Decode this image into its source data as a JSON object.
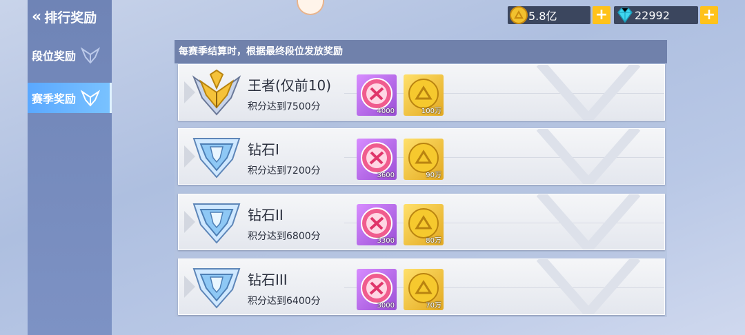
{
  "header": {
    "back_label": "排行奖励"
  },
  "nav": [
    {
      "label": "段位奖励",
      "active": false
    },
    {
      "label": "赛季奖励",
      "active": true
    }
  ],
  "currencies": {
    "coins": "5.8亿",
    "diamonds": "22992",
    "plus": "+"
  },
  "panel": {
    "notice": "每赛季结算时，根据最终段位发放奖励"
  },
  "ranks": [
    {
      "name": "王者(仅前10)",
      "requirement": "积分达到7500分",
      "reward1_qty": "4000",
      "reward2_qty": "100万",
      "icon": "king-emblem"
    },
    {
      "name": "钻石I",
      "requirement": "积分达到7200分",
      "reward1_qty": "3600",
      "reward2_qty": "90万",
      "icon": "diamond-emblem"
    },
    {
      "name": "钻石II",
      "requirement": "积分达到6800分",
      "reward1_qty": "3300",
      "reward2_qty": "80万",
      "icon": "diamond-emblem"
    },
    {
      "name": "钻石III",
      "requirement": "积分达到6400分",
      "reward1_qty": "3000",
      "reward2_qty": "70万",
      "icon": "diamond-emblem"
    }
  ],
  "colors": {
    "accent": "#5aa8ff",
    "gold": "#ffc21a",
    "header": "#7081ab",
    "sidebar": "#7489bb"
  }
}
